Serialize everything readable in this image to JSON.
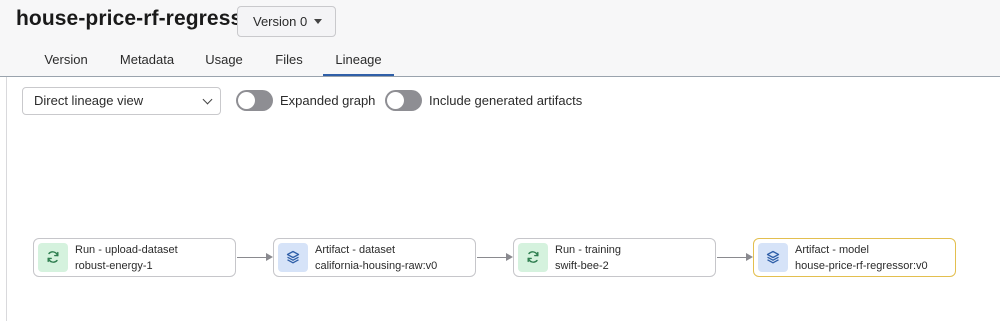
{
  "header": {
    "title": "house-price-rf-regressor",
    "version_label": "Version 0"
  },
  "tabs": [
    {
      "label": "Version",
      "active": false
    },
    {
      "label": "Metadata",
      "active": false
    },
    {
      "label": "Usage",
      "active": false
    },
    {
      "label": "Files",
      "active": false
    },
    {
      "label": "Lineage",
      "active": true
    }
  ],
  "controls": {
    "view_select": "Direct lineage view",
    "expanded_graph": {
      "label": "Expanded graph",
      "on": false
    },
    "include_generated": {
      "label": "Include generated artifacts",
      "on": false
    }
  },
  "lineage": {
    "nodes": [
      {
        "kind": "run",
        "icon": "refresh-icon",
        "title": "Run - upload-dataset",
        "name": "robust-energy-1",
        "highlighted": false
      },
      {
        "kind": "artifact",
        "icon": "layers-icon",
        "title": "Artifact - dataset",
        "name": "california-housing-raw:v0",
        "highlighted": false
      },
      {
        "kind": "run",
        "icon": "refresh-icon",
        "title": "Run - training",
        "name": "swift-bee-2",
        "highlighted": false
      },
      {
        "kind": "artifact",
        "icon": "layers-icon",
        "title": "Artifact - model",
        "name": "house-price-rf-regressor:v0",
        "highlighted": true
      }
    ]
  },
  "colors": {
    "run_icon_bg": "#d5f2de",
    "artifact_icon_bg": "#d6e3f8",
    "run_icon": "#2e7d4f",
    "artifact_icon": "#2f5fa8",
    "highlight_border": "#e3bf4f",
    "active_tab": "#2f5fa8"
  }
}
